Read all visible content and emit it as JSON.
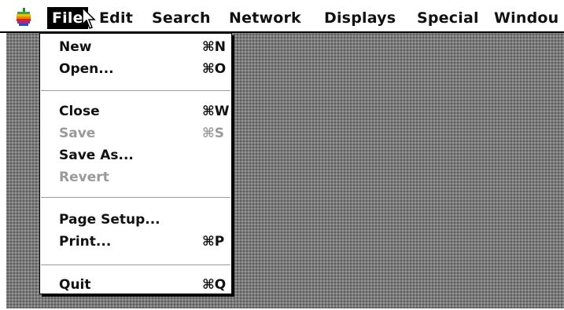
{
  "menubar": {
    "items": [
      {
        "label": "File",
        "active": true
      },
      {
        "label": "Edit"
      },
      {
        "label": "Search"
      },
      {
        "label": "Network"
      },
      {
        "label": "Displays"
      },
      {
        "label": "Special"
      },
      {
        "label": "Windou"
      }
    ]
  },
  "file_menu": {
    "items": [
      {
        "label": "New",
        "shortcut": "⌘N",
        "enabled": true
      },
      {
        "label": "Open...",
        "shortcut": "⌘O",
        "enabled": true
      },
      {
        "label": "Close",
        "shortcut": "⌘W",
        "enabled": true
      },
      {
        "label": "Save",
        "shortcut": "⌘S",
        "enabled": false
      },
      {
        "label": "Save As...",
        "shortcut": "",
        "enabled": true
      },
      {
        "label": "Revert",
        "shortcut": "",
        "enabled": false
      },
      {
        "label": "Page Setup...",
        "shortcut": "",
        "enabled": true
      },
      {
        "label": "Print...",
        "shortcut": "⌘P",
        "enabled": true
      },
      {
        "label": "Quit",
        "shortcut": "⌘Q",
        "enabled": true
      }
    ]
  },
  "icons": {
    "apple_menu": "apple-icon",
    "pointer": "arrow-cursor-icon"
  }
}
